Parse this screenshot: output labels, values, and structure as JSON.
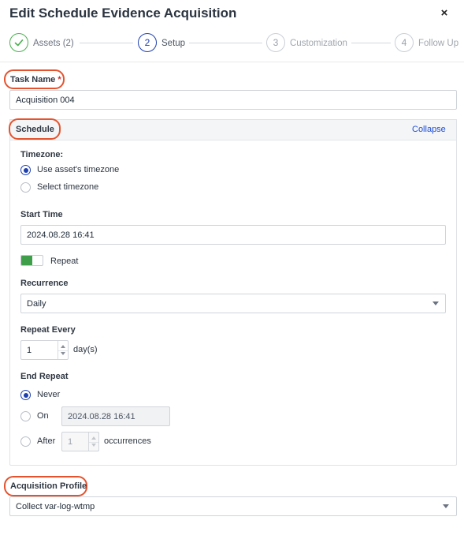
{
  "dialog": {
    "title": "Edit Schedule Evidence Acquisition",
    "close_label": "×"
  },
  "steps": [
    {
      "number": "",
      "label": "Assets (2)",
      "state": "done"
    },
    {
      "number": "2",
      "label": "Setup",
      "state": "active"
    },
    {
      "number": "3",
      "label": "Customization",
      "state": "pending"
    },
    {
      "number": "4",
      "label": "Follow Up",
      "state": "pending"
    }
  ],
  "task_name": {
    "label": "Task Name",
    "required_mark": "*",
    "value": "Acquisition 004"
  },
  "schedule": {
    "title": "Schedule",
    "collapse_label": "Collapse",
    "timezone": {
      "label": "Timezone:",
      "options": [
        "Use asset's timezone",
        "Select timezone"
      ],
      "selected": "Use asset's timezone"
    },
    "start_time": {
      "label": "Start Time",
      "value": "2024.08.28 16:41"
    },
    "repeat": {
      "label": "Repeat",
      "enabled": true
    },
    "recurrence": {
      "label": "Recurrence",
      "value": "Daily"
    },
    "repeat_every": {
      "label": "Repeat Every",
      "value": "1",
      "unit": "day(s)"
    },
    "end_repeat": {
      "label": "End Repeat",
      "never_label": "Never",
      "on_label": "On",
      "on_value": "2024.08.28 16:41",
      "after_label": "After",
      "after_value": "1",
      "after_unit": "occurrences",
      "selected": "Never"
    }
  },
  "acquisition_profile": {
    "label": "Acquisition Profile",
    "value": "Collect var-log-wtmp"
  },
  "colors": {
    "accent": "#1e40af",
    "success": "#4caf50",
    "toggle_on": "#3f9e4a",
    "highlight": "#e4532e",
    "link": "#1d4ed8"
  }
}
